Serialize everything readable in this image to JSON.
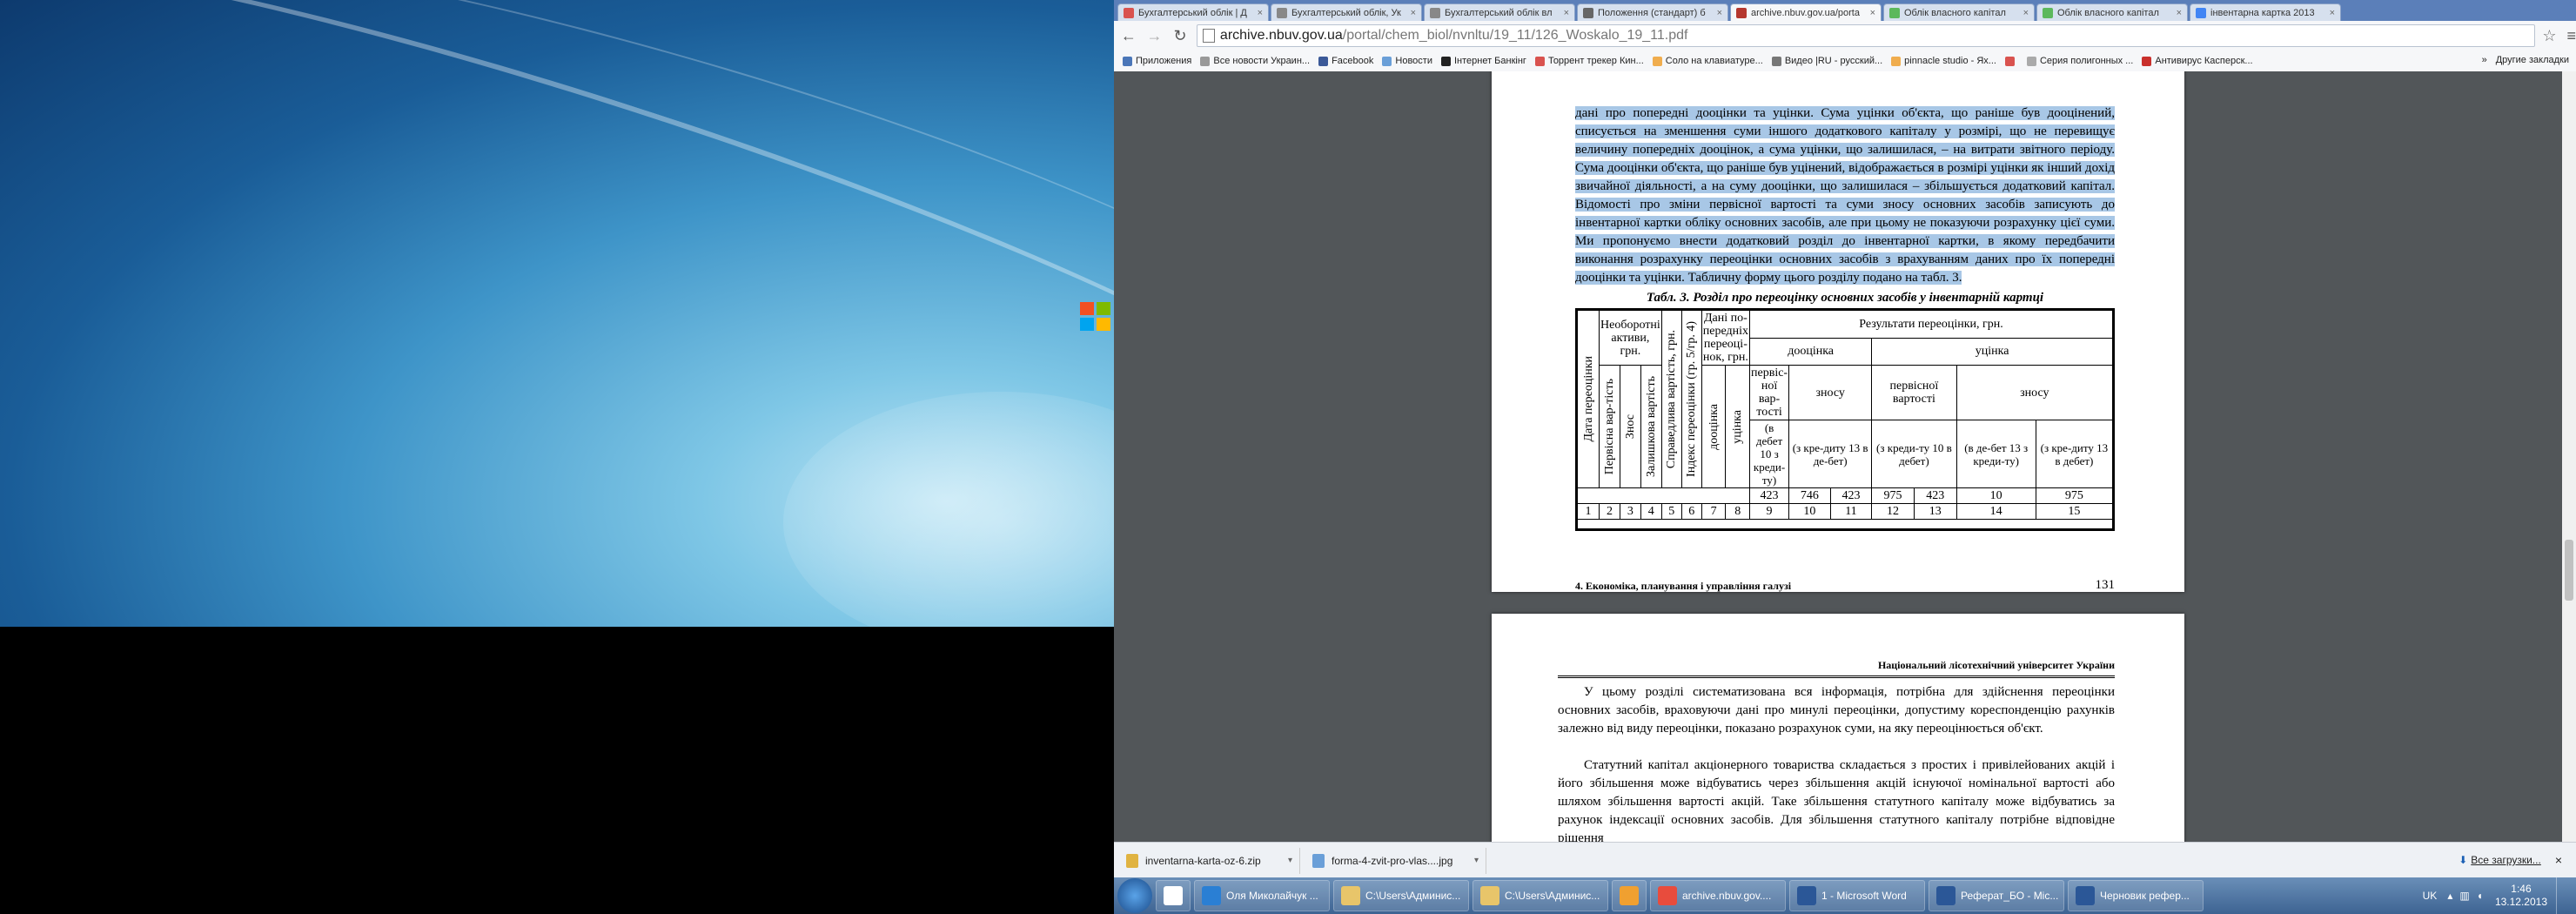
{
  "browser": {
    "tabs": [
      {
        "title": "Бухгалтерський облік | Д",
        "color": "#d9534f"
      },
      {
        "title": "Бухгалтерський облік, Ук",
        "color": "#888888"
      },
      {
        "title": "Бухгалтерський облік вл",
        "color": "#888888"
      },
      {
        "title": "Положення (стандарт) б",
        "color": "#666666"
      },
      {
        "title": "archive.nbuv.gov.ua/porta",
        "color": "#b5372e",
        "active": true
      },
      {
        "title": "Облік власного капітал",
        "color": "#5cb85c"
      },
      {
        "title": "Облік власного капітал",
        "color": "#5cb85c"
      },
      {
        "title": "інвентарна картка 2013",
        "color": "#4285f4"
      }
    ],
    "close_glyph": "×",
    "url_host": "archive.nbuv.gov.ua",
    "url_path": "/portal/chem_biol/nvnltu/19_11/126_Woskalo_19_11.pdf",
    "back_glyph": "←",
    "forward_glyph": "→",
    "reload_glyph": "↻",
    "star_glyph": "☆",
    "menu_glyph": "≡",
    "bookmarks": [
      {
        "label": "Приложения",
        "color": "#4a76b8"
      },
      {
        "label": "Все новости Украин...",
        "color": "#999999"
      },
      {
        "label": "Facebook",
        "color": "#3b5998"
      },
      {
        "label": "Новости",
        "color": "#6a9fd8"
      },
      {
        "label": "Інтернет Банкінг",
        "color": "#222222"
      },
      {
        "label": "Торрент трекер Кин...",
        "color": "#d9534f"
      },
      {
        "label": "Соло на клавиатуре...",
        "color": "#f0ad4e"
      },
      {
        "label": "Видео |RU - русский...",
        "color": "#777777"
      },
      {
        "label": "pinnacle studio - Ях...",
        "color": "#f0ad4e"
      },
      {
        "label": "",
        "color": "#d9534f"
      },
      {
        "label": "Серия полигонных ...",
        "color": "#aaaaaa"
      },
      {
        "label": "Антивирус Касперск...",
        "color": "#c9302c"
      }
    ],
    "bookmarks_more": "»",
    "other_bookmarks": "Другие закладки"
  },
  "pdf": {
    "page1": {
      "paragraph": "дані про попередні дооцінки та уцінки. Сума уцінки об'єкта, що раніше був дооцінений, списується на зменшення суми іншого додаткового капіталу у розмірі, що не перевищує величину попередніх дооцінок, а сума уцінки, що залишилася, – на витрати звітного періоду. Сума дооцінки об'єкта, що раніше був уцінений, відображається в розмірі уцінки як інший дохід звичайної діяльності, а на суму дооцінки, що залишилася – збільшується додатковий капітал. Відомості про зміни первісної вартості та суми зносу основних засобів записують до інвентарної картки обліку основних засобів, але при цьому не показуючи розрахунку цієї суми. Ми пропонуємо внести додатковий розділ до інвентарної картки, в якому передбачити виконання розрахунку переоцінки основних засобів з врахуванням даних про їх попередні дооцінки та уцінки. Табличну форму цього розділу подано на табл. 3.",
      "table_caption": "Табл. 3. Розділ про переоцінку основних засобів у інвентарній картці",
      "table": {
        "results_header": "Результати переоцінки, грн.",
        "date": "Дата переоцінки",
        "noncurrent": "Необоротні активи, грн.",
        "initial_cost": "Первісна вар-тість",
        "wear": "Знос",
        "residual": "Залишкова вартість",
        "fair_value": "Справедлива вартість, грн.",
        "index": "Індекс переоцінки (гр. 5/гр. 4)",
        "prev_data": "Дані по-передніх переоці-нок, грн.",
        "revaluation_up": "дооцінка",
        "revaluation_down": "уцінка",
        "dooc": "дооцінка",
        "utsin": "уцінка",
        "initial_value_of": "первіс-ної вар-тості",
        "wear_of": "зносу",
        "initial_value2": "первісної вартості",
        "wear2": "зносу",
        "c1": "(в дебет 10 з креди-ту)",
        "c2": "(з кре-диту 13 в де-бет)",
        "c3": "(з креди-ту 10 в дебет)",
        "c4": "(в де-бет 13 з креди-ту)",
        "c5": "(з кре-диту 13 в дебет)",
        "accounts": [
          "423",
          "746",
          "423",
          "975",
          "423",
          "10",
          "975"
        ],
        "numbers": [
          "1",
          "2",
          "3",
          "4",
          "5",
          "6",
          "7",
          "8",
          "9",
          "10",
          "11",
          "12",
          "13",
          "14",
          "15"
        ]
      },
      "footer_left": "4. Економіка, планування і управління галузі",
      "page_number": "131"
    },
    "page2": {
      "header": "Національний лісотехнічний університет України",
      "para1": "У цьому розділі систематизована вся інформація, потрібна для здійснення переоцінки основних засобів, враховуючи дані про минулі переоцінки, допустиму кореспонденцію рахунків залежно від виду переоцінки, показано розрахунок суми, на яку переоцінюється об'єкт.",
      "para2": "Статутний капітал акціонерного товариства складається з простих і привілейованих акцій і його збільшення може відбуватись через збільшення акцій існуючої номінальної вартості або шляхом збільшення вартості акцій. Таке збільшення статутного капіталу може відбуватись за рахунок індексації основних засобів. Для збільшення статутного капіталу потрібне відповідне рішення"
    }
  },
  "downloads": {
    "items": [
      {
        "name": "inventarna-karta-oz-6.zip",
        "color": "#e0b341"
      },
      {
        "name": "forma-4-zvit-pro-vlas....jpg",
        "color": "#6a9fd8"
      }
    ],
    "dropdown_glyph": "▾",
    "all_downloads": "Все загрузки...",
    "close_glyph": "×"
  },
  "taskbar": {
    "items": [
      {
        "label": "",
        "color": "#ffffff",
        "wide": false
      },
      {
        "label": "Оля Миколайчук ...",
        "color": "#2a7fd4",
        "wide": true
      },
      {
        "label": "C:\\Users\\Админис...",
        "color": "#e8c56a",
        "wide": true
      },
      {
        "label": "C:\\Users\\Админис...",
        "color": "#e8c56a",
        "wide": true
      },
      {
        "label": "",
        "color": "#f0a030",
        "wide": false
      },
      {
        "label": "archive.nbuv.gov....",
        "color": "#e84c3d",
        "wide": true
      },
      {
        "label": "1 - Microsoft Word",
        "color": "#2b5797",
        "wide": true
      },
      {
        "label": "Реферат_БО - Mic...",
        "color": "#2b5797",
        "wide": true
      },
      {
        "label": "Черновик рефер...",
        "color": "#2b5797",
        "wide": true
      }
    ],
    "lang": "UK",
    "time": "1:46",
    "date": "13.12.2013"
  }
}
